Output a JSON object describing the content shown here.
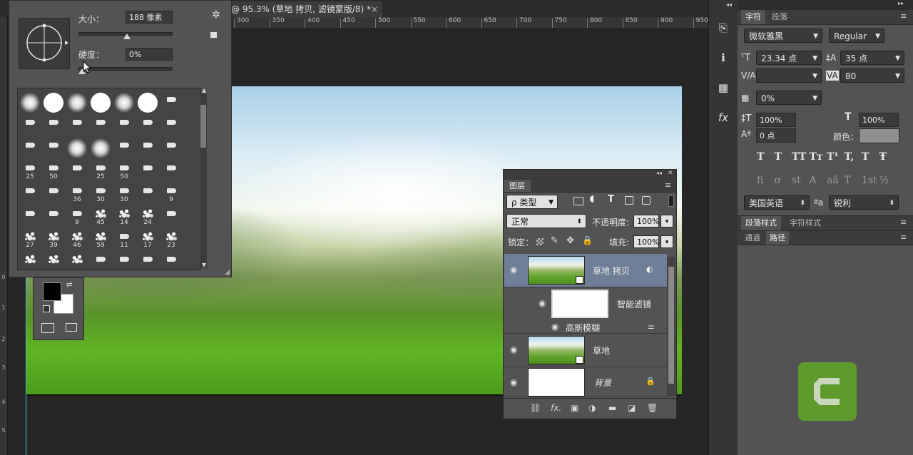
{
  "document": {
    "tab_title": "@ 95.3% (草地 拷贝, 滤镜蒙版/8) *",
    "tab_close": "×",
    "ruler_ticks": [
      "300",
      "350",
      "400",
      "450",
      "500",
      "550",
      "600",
      "650",
      "700",
      "750",
      "800",
      "850",
      "900",
      "950"
    ],
    "left_ruler_numbers": [
      "0",
      "1",
      "2",
      "3",
      "4",
      "5"
    ]
  },
  "brush_panel": {
    "size_label": "大小：",
    "size_value": "188 像素",
    "size_level_percent": 52,
    "hardness_label": "硬度：",
    "hardness_value": "0%",
    "hardness_level_percent": 0,
    "gear_icon": "gear-icon",
    "new_preset_icon": "new-preset-icon",
    "grid_rows": [
      {
        "cells": [
          {
            "k": "soft",
            "n": ""
          },
          {
            "k": "hard",
            "n": ""
          },
          {
            "k": "soft",
            "n": ""
          },
          {
            "k": "hard",
            "n": ""
          },
          {
            "k": "soft",
            "n": ""
          },
          {
            "k": "hard",
            "n": ""
          },
          {
            "k": "small",
            "n": ""
          }
        ]
      },
      {
        "cells": [
          {
            "k": "small",
            "n": ""
          },
          {
            "k": "small",
            "n": ""
          },
          {
            "k": "small",
            "n": ""
          },
          {
            "k": "small",
            "n": ""
          },
          {
            "k": "small",
            "n": ""
          },
          {
            "k": "small",
            "n": ""
          },
          {
            "k": "small",
            "n": ""
          }
        ]
      },
      {
        "cells": [
          {
            "k": "small",
            "n": ""
          },
          {
            "k": "small",
            "n": ""
          },
          {
            "k": "soft",
            "n": ""
          },
          {
            "k": "soft",
            "n": ""
          },
          {
            "k": "small",
            "n": ""
          },
          {
            "k": "small",
            "n": ""
          },
          {
            "k": "small",
            "n": ""
          }
        ]
      },
      {
        "cells": [
          {
            "k": "small",
            "n": "25"
          },
          {
            "k": "small",
            "n": "50"
          },
          {
            "k": "small",
            "n": ""
          },
          {
            "k": "small",
            "n": "25"
          },
          {
            "k": "small",
            "n": "50"
          },
          {
            "k": "small",
            "n": ""
          },
          {
            "k": "small",
            "n": ""
          }
        ]
      },
      {
        "cells": [
          {
            "k": "small",
            "n": ""
          },
          {
            "k": "small",
            "n": ""
          },
          {
            "k": "small",
            "n": "36"
          },
          {
            "k": "small",
            "n": "30"
          },
          {
            "k": "small",
            "n": "30"
          },
          {
            "k": "small",
            "n": ""
          },
          {
            "k": "small",
            "n": "9"
          }
        ]
      },
      {
        "cells": [
          {
            "k": "small",
            "n": ""
          },
          {
            "k": "small",
            "n": ""
          },
          {
            "k": "small",
            "n": "9"
          },
          {
            "k": "splat",
            "n": "45"
          },
          {
            "k": "splat",
            "n": "14"
          },
          {
            "k": "splat",
            "n": "24"
          },
          {
            "k": "small",
            "n": ""
          }
        ]
      },
      {
        "cells": [
          {
            "k": "splat",
            "n": "27"
          },
          {
            "k": "splat",
            "n": "39"
          },
          {
            "k": "splat",
            "n": "46"
          },
          {
            "k": "splat",
            "n": "59"
          },
          {
            "k": "small",
            "n": "11"
          },
          {
            "k": "splat",
            "n": "17"
          },
          {
            "k": "splat",
            "n": "23"
          }
        ]
      },
      {
        "cells": [
          {
            "k": "splat",
            "n": ""
          },
          {
            "k": "splat",
            "n": ""
          },
          {
            "k": "splat",
            "n": ""
          },
          {
            "k": "small",
            "n": ""
          },
          {
            "k": "small",
            "n": ""
          },
          {
            "k": "small",
            "n": ""
          },
          {
            "k": "small",
            "n": ""
          }
        ]
      }
    ]
  },
  "colors": {
    "foreground": "#000000",
    "background": "#ffffff"
  },
  "layers_panel": {
    "tab_label": "图层",
    "collapse_glyph": "◂◂",
    "close_glyph": "✕",
    "menu_glyph": "≡",
    "filter_kind": "ρ 类型",
    "blend_mode": "正常",
    "opacity_label": "不透明度:",
    "opacity_value": "100%",
    "lock_label": "锁定：",
    "fill_label": "填充:",
    "fill_value": "100%",
    "layers": [
      {
        "name": "草地 拷贝",
        "type": "smart-object",
        "selected": true
      },
      {
        "name": "智能滤镜",
        "type": "filter-mask"
      },
      {
        "name": "高斯模糊",
        "type": "filter"
      },
      {
        "name": "草地",
        "type": "smart-object"
      },
      {
        "name": "背景",
        "type": "background",
        "locked": true
      }
    ],
    "footer_icons": [
      "link-icon",
      "fx-icon",
      "mask-icon",
      "adjustment-icon",
      "folder-icon",
      "new-layer-icon",
      "trash-icon"
    ]
  },
  "character_panel": {
    "tab_character": "字符",
    "tab_paragraph": "段落",
    "font_family": "微软雅黑",
    "font_style": "Regular",
    "font_size": "23.34 点",
    "leading": "35 点",
    "kerning": "",
    "tracking": "80",
    "tsume": "0%",
    "vertical_scale": "100%",
    "horizontal_scale": "100%",
    "baseline_shift": "0 点",
    "color_label": "颜色：",
    "text_color": "#8f8f8f",
    "language": "美国英语",
    "aa_label": "ªa",
    "antialias": "锐利",
    "type_buttons": [
      "T",
      "T",
      "TT",
      "Tт",
      "T¹",
      "T,",
      "T",
      "Ŧ"
    ],
    "opentype_buttons": [
      "fi",
      "ơ",
      "st",
      "A",
      "aā",
      "T",
      "1st",
      "½"
    ],
    "tab_para_styles": "段落样式",
    "tab_char_styles": "字符样式",
    "tab_channels": "通道",
    "tab_paths": "路径"
  }
}
